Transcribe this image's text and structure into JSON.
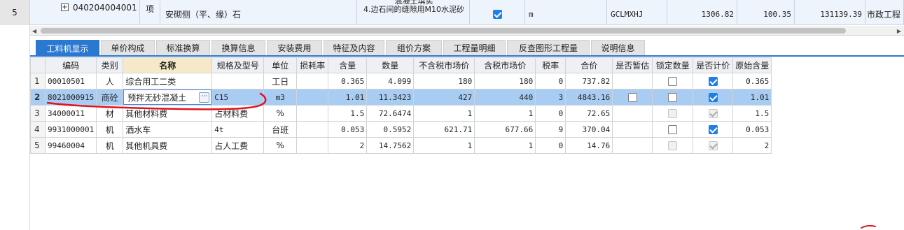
{
  "top_row": {
    "index": "5",
    "expand": "+",
    "code": "040204004001",
    "unit_type": "项",
    "name": "安砌侧（平、缘）石",
    "features": [
      "混凝土填实",
      "4.边石间的缝隙用M10水泥砂"
    ],
    "checked": true,
    "unit": "m",
    "category_code": "GCLMXHJ",
    "quantity": "1306.82",
    "unit_price": "100.35",
    "total": "131139.39",
    "project_type": "市政工程"
  },
  "tabs": [
    {
      "label": "工料机显示",
      "active": true
    },
    {
      "label": "单价构成"
    },
    {
      "label": "标准换算"
    },
    {
      "label": "换算信息"
    },
    {
      "label": "安装费用"
    },
    {
      "label": "特征及内容"
    },
    {
      "label": "组价方案"
    },
    {
      "label": "工程量明细"
    },
    {
      "label": "反查图形工程量"
    },
    {
      "label": "说明信息"
    }
  ],
  "headers": [
    "",
    "编码",
    "类别",
    "名称",
    "规格及型号",
    "单位",
    "损耗率",
    "含量",
    "数量",
    "不含税市场价",
    "含税市场价",
    "税率",
    "合价",
    "是否暂估",
    "锁定数量",
    "是否计价",
    "原始含量"
  ],
  "rows": [
    {
      "idx": "1",
      "code": "00010501",
      "cat": "人",
      "name": "综合用工二类",
      "spec": "",
      "unit": "工日",
      "loss": "",
      "content": "0.365",
      "qty": "4.099",
      "price_ex": "180",
      "price_in": "180",
      "tax": "0",
      "total": "737.82",
      "est": "none",
      "lock": "off",
      "priced": "on",
      "orig": "0.365"
    },
    {
      "idx": "2",
      "code": "8021000915",
      "cat": "商砼",
      "name": "预拌无砂混凝土",
      "spec": "C15",
      "unit": "m3",
      "loss": "",
      "content": "1.01",
      "qty": "11.3423",
      "price_ex": "427",
      "price_in": "440",
      "tax": "3",
      "total": "4843.16",
      "est": "off",
      "lock": "off",
      "priced": "on",
      "orig": "1.01"
    },
    {
      "idx": "3",
      "code": "34000011",
      "cat": "材",
      "name": "其他材料费",
      "spec": "占材料费",
      "unit": "%",
      "loss": "",
      "content": "1.5",
      "qty": "72.6474",
      "price_ex": "1",
      "price_in": "1",
      "tax": "0",
      "total": "72.65",
      "est": "none",
      "lock": "dim",
      "priced": "dim-on",
      "orig": "1.5"
    },
    {
      "idx": "4",
      "code": "9931000001",
      "cat": "机",
      "name": "洒水车",
      "spec": "4t",
      "unit": "台班",
      "loss": "",
      "content": "0.053",
      "qty": "0.5952",
      "price_ex": "621.71",
      "price_in": "677.66",
      "tax": "9",
      "total": "370.04",
      "est": "none",
      "lock": "off",
      "priced": "on",
      "orig": "0.053"
    },
    {
      "idx": "5",
      "code": "99460004",
      "cat": "机",
      "name": "其他机具费",
      "spec": "占人工费",
      "unit": "%",
      "loss": "",
      "content": "2",
      "qty": "14.7562",
      "price_ex": "1",
      "price_in": "1",
      "tax": "0",
      "total": "14.76",
      "est": "none",
      "lock": "dim",
      "priced": "dim-on",
      "orig": "2"
    }
  ],
  "edit_button": "···",
  "colors": {
    "accent": "#2b78d0",
    "selected_row": "#a9cdf2",
    "annotation": "#e0141e",
    "checkbox_on": "#1e7fe6"
  }
}
